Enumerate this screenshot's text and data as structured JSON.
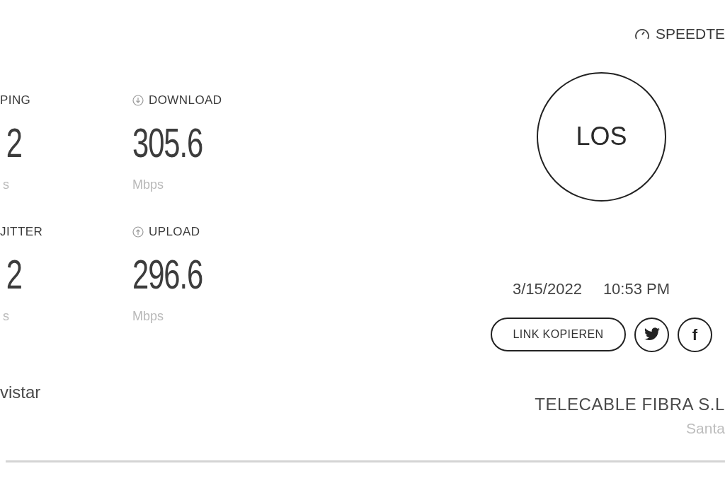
{
  "brand": {
    "label": "SPEEDTE"
  },
  "metrics": [
    {
      "kind": "plain",
      "label": "PING",
      "value": "2",
      "unit": "s"
    },
    {
      "kind": "download",
      "label": "DOWNLOAD",
      "value": "305.6",
      "unit": "Mbps"
    },
    {
      "kind": "plain",
      "label": "JITTER",
      "value": "2",
      "unit": "s"
    },
    {
      "kind": "upload",
      "label": "UPLOAD",
      "value": "296.6",
      "unit": "Mbps"
    }
  ],
  "isp": {
    "name": "vistar"
  },
  "result": {
    "label": "LOS"
  },
  "date": "3/15/2022",
  "time": "10:53 PM",
  "share": {
    "copy_label": "LINK KOPIEREN",
    "networks": [
      {
        "kind": "twitter"
      },
      {
        "kind": "facebook",
        "glyph": "f"
      }
    ]
  },
  "server": {
    "name": "TELECABLE FIBRA S.L",
    "location": "Santa"
  }
}
